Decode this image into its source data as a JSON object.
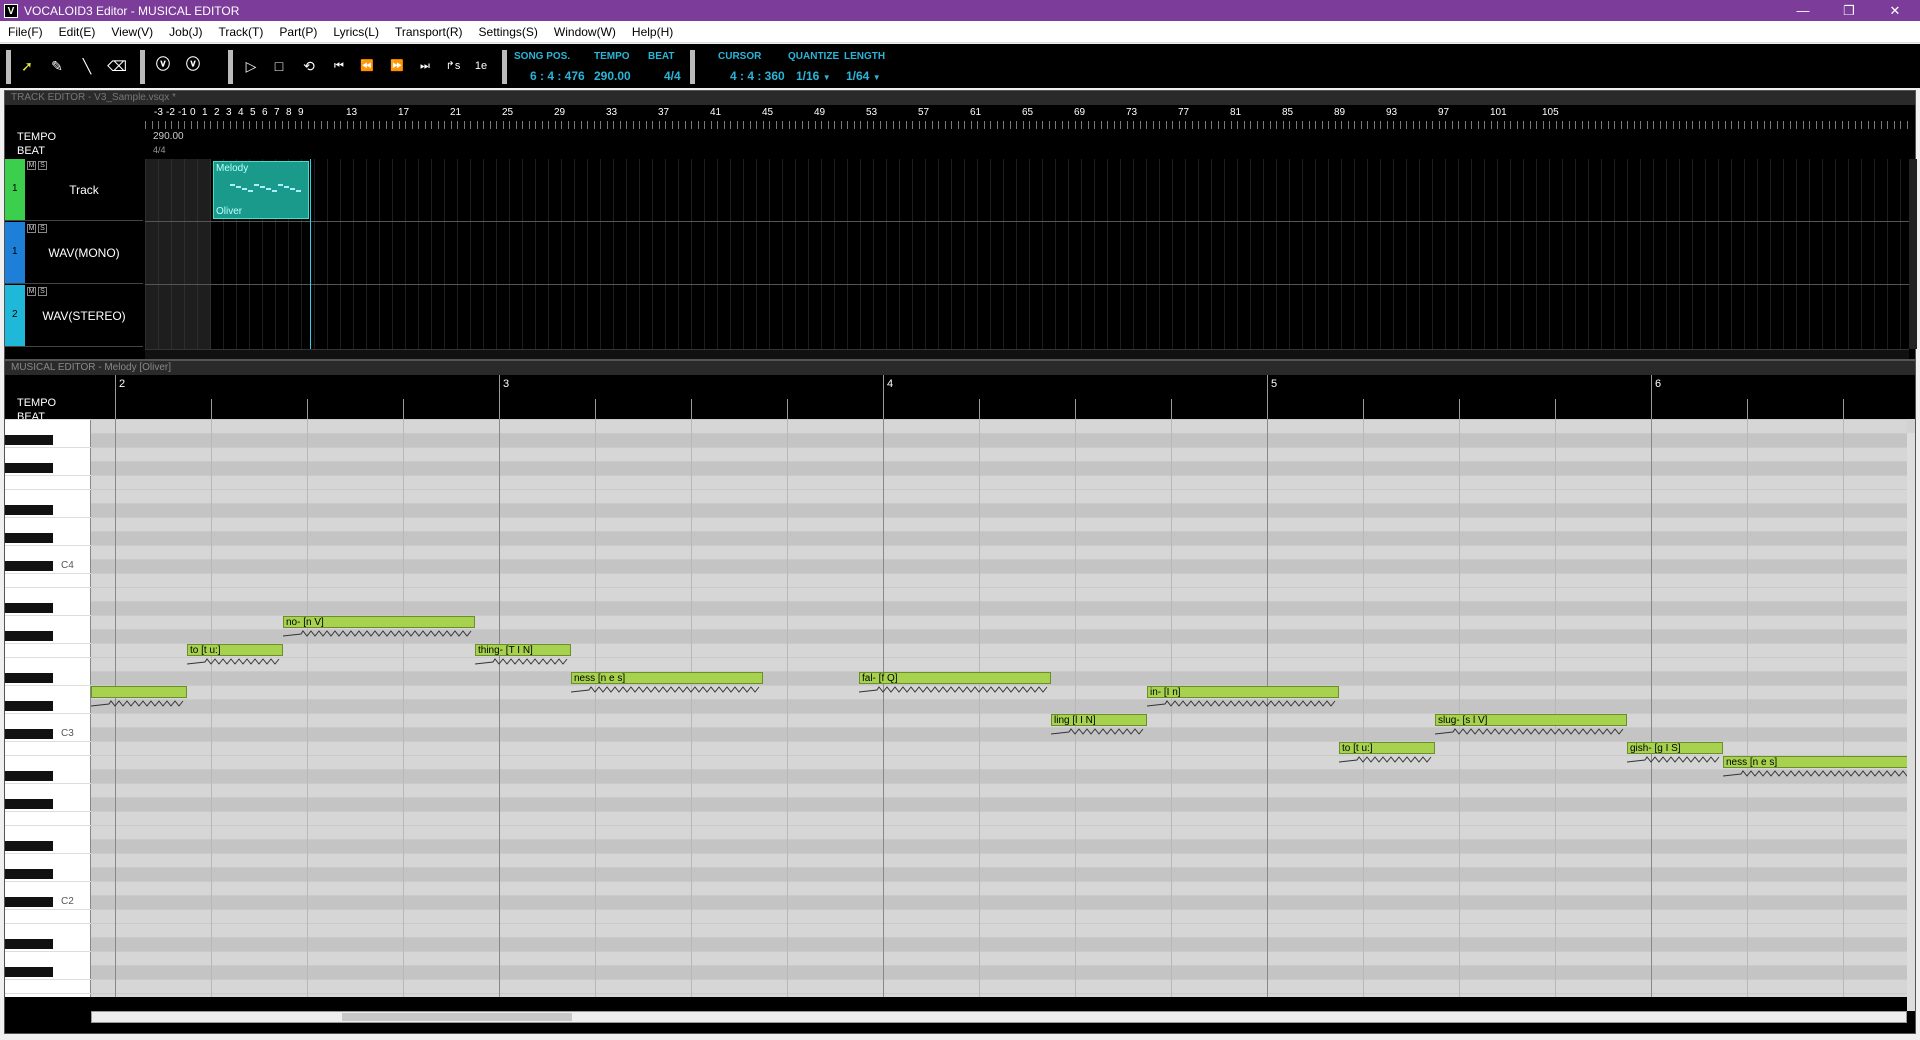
{
  "window": {
    "title": "VOCALOID3 Editor - MUSICAL EDITOR",
    "app_icon_letter": "V",
    "controls": {
      "minimize": "—",
      "restore": "❐",
      "close": "✕"
    }
  },
  "menu": [
    "File(F)",
    "Edit(E)",
    "View(V)",
    "Job(J)",
    "Track(T)",
    "Part(P)",
    "Lyrics(L)",
    "Transport(R)",
    "Settings(S)",
    "Window(W)",
    "Help(H)"
  ],
  "toolbar": {
    "song_pos": {
      "label": "SONG POS.",
      "value": "6 : 4 : 476"
    },
    "tempo": {
      "label": "TEMPO",
      "value": "290.00"
    },
    "beat": {
      "label": "BEAT",
      "value": "4/4"
    },
    "cursor": {
      "label": "CURSOR",
      "value": "4 : 4 : 360"
    },
    "quantize": {
      "label": "QUANTIZE",
      "value": "1/16"
    },
    "length": {
      "label": "LENGTH",
      "value": "1/64"
    }
  },
  "track_editor": {
    "header": "TRACK EDITOR - V3_Sample.vsqx *",
    "tempo_label": "TEMPO",
    "tempo_value": "290.00",
    "beat_label": "BEAT",
    "beat_value": "4/4",
    "ruler": [
      "-3",
      "-2",
      "-1",
      "0",
      "1",
      "2",
      "3",
      "4",
      "5",
      "6",
      "7",
      "8",
      "9",
      "13",
      "17",
      "21",
      "25",
      "29",
      "33",
      "37",
      "41",
      "45",
      "49",
      "53",
      "57",
      "61",
      "65",
      "69",
      "73",
      "77",
      "81",
      "85",
      "89",
      "93",
      "97",
      "101",
      "105"
    ],
    "tracks": [
      {
        "number": "1",
        "name": "Track",
        "color": "#3ccf4e"
      },
      {
        "number": "1",
        "name": "WAV(MONO)",
        "color": "#1e7fd8"
      },
      {
        "number": "2",
        "name": "WAV(STEREO)",
        "color": "#1fb8d8"
      }
    ],
    "part": {
      "name": "Melody",
      "singer": "Oliver"
    },
    "ms_m": "M",
    "ms_s": "S"
  },
  "musical_editor": {
    "header": "MUSICAL EDITOR - Melody [Oliver]",
    "tempo_label": "TEMPO",
    "beat_label": "BEAT",
    "measures": [
      "2",
      "3",
      "4",
      "5",
      "6"
    ],
    "octave_labels": [
      "C4",
      "C3",
      "C2"
    ],
    "notes": [
      {
        "lyric": "",
        "start_ticks": 0,
        "length_ticks": 480,
        "row": 19
      },
      {
        "lyric": "to [t u:]",
        "start_ticks": 480,
        "length_ticks": 480,
        "row": 16
      },
      {
        "lyric": "no- [n V]",
        "start_ticks": 960,
        "length_ticks": 960,
        "row": 14
      },
      {
        "lyric": "thing- [T I N]",
        "start_ticks": 1920,
        "length_ticks": 480,
        "row": 16
      },
      {
        "lyric": "ness [n e s]",
        "start_ticks": 2400,
        "length_ticks": 960,
        "row": 18
      },
      {
        "lyric": "fal- [f Q]",
        "start_ticks": 3840,
        "length_ticks": 960,
        "row": 18
      },
      {
        "lyric": "ling [l I N]",
        "start_ticks": 4800,
        "length_ticks": 480,
        "row": 21
      },
      {
        "lyric": "in- [I n]",
        "start_ticks": 5280,
        "length_ticks": 960,
        "row": 19
      },
      {
        "lyric": "to [t u:]",
        "start_ticks": 6240,
        "length_ticks": 480,
        "row": 23
      },
      {
        "lyric": "slug- [s l V]",
        "start_ticks": 6720,
        "length_ticks": 960,
        "row": 21
      },
      {
        "lyric": "gish- [g I S]",
        "start_ticks": 7680,
        "length_ticks": 480,
        "row": 23
      },
      {
        "lyric": "ness [n e s]",
        "start_ticks": 8160,
        "length_ticks": 960,
        "row": 24
      }
    ]
  }
}
